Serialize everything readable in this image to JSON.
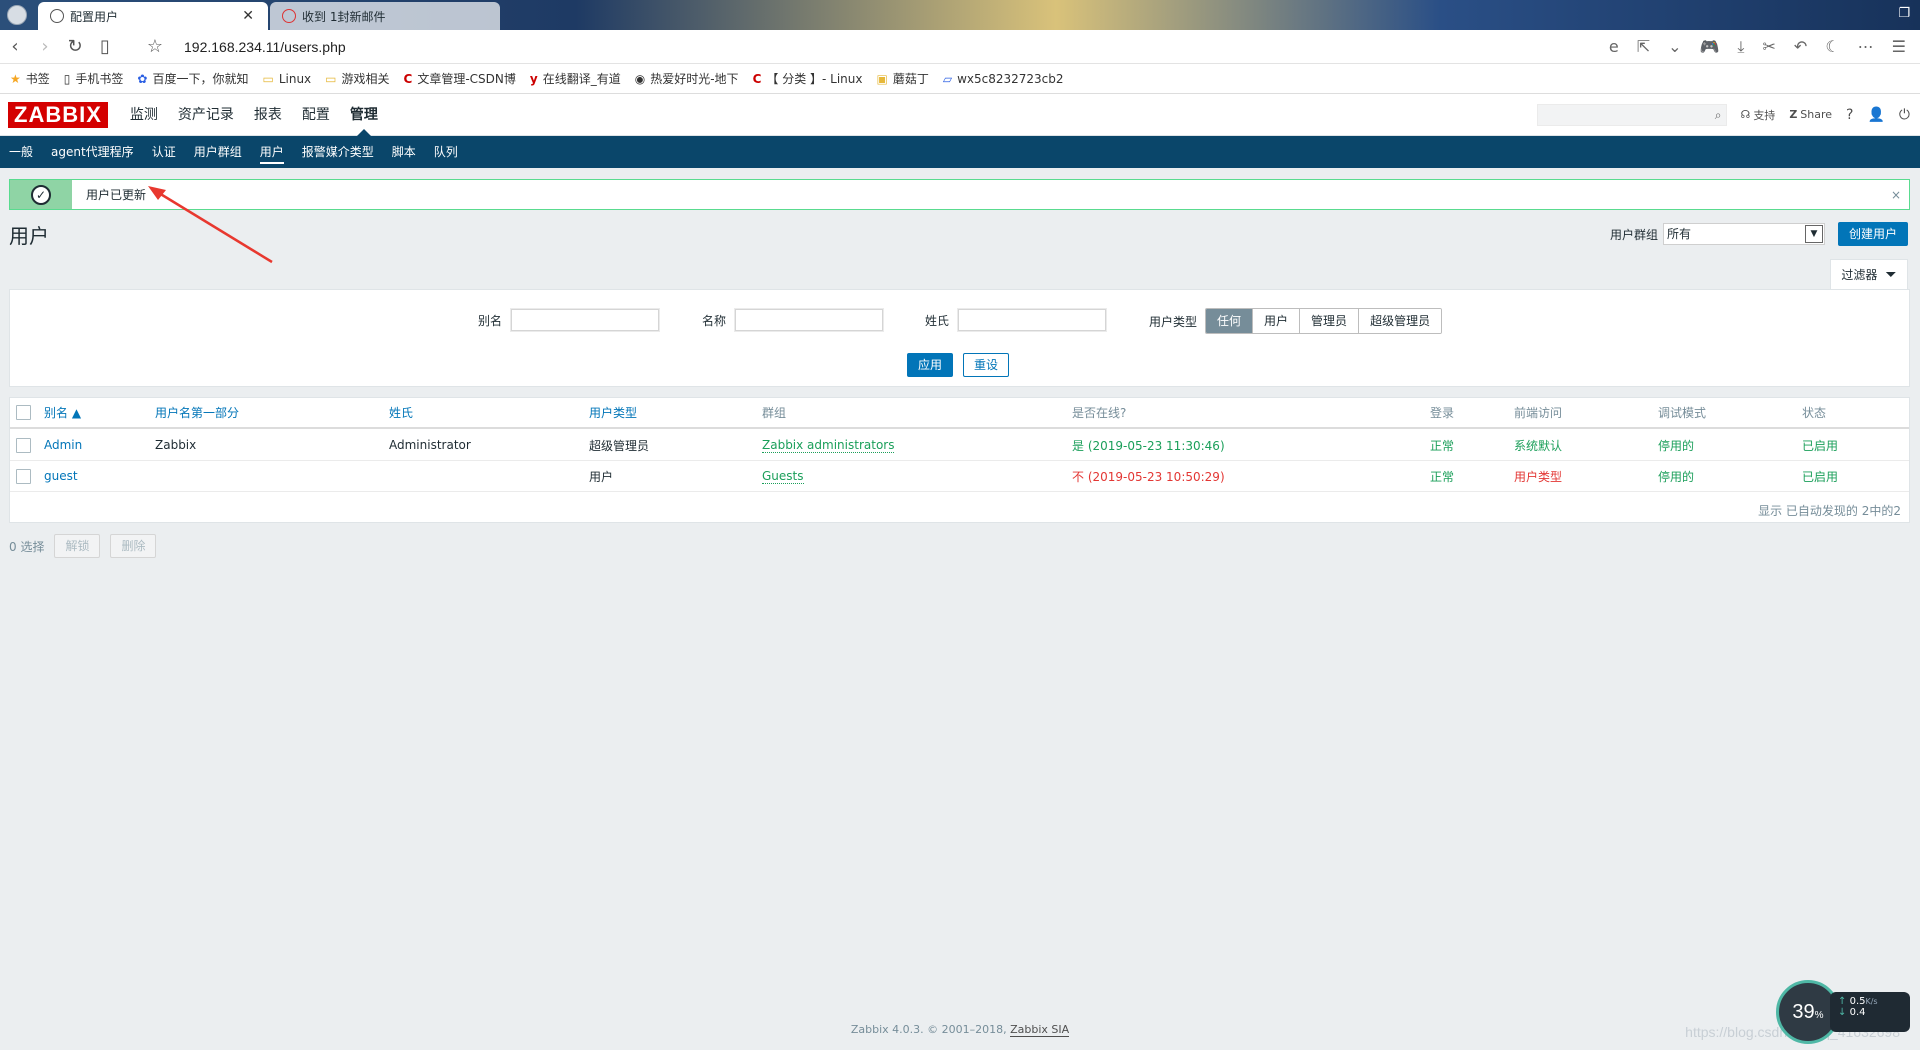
{
  "browser": {
    "active_tab": "配置用户",
    "inactive_tab": "收到 1封新邮件",
    "url": "192.168.234.11/users.php",
    "bookmarks": [
      "书签",
      "手机书签",
      "百度一下，你就知",
      "Linux",
      "游戏相关",
      "文章管理-CSDN博",
      "在线翻译_有道",
      "热爱好时光-地下",
      "【 分类 】- Linux",
      "蘑菇丁",
      "wx5c8232723cb2"
    ]
  },
  "header": {
    "logo": "ZABBIX",
    "menu": [
      "监测",
      "资产记录",
      "报表",
      "配置",
      "管理"
    ],
    "selected_menu": "管理",
    "support": "支持",
    "share": "Share",
    "help": "?"
  },
  "subnav": [
    "一般",
    "agent代理程序",
    "认证",
    "用户群组",
    "用户",
    "报警媒介类型",
    "脚本",
    "队列"
  ],
  "message": {
    "text": "用户已更新",
    "close": "×"
  },
  "page": {
    "title": "用户",
    "group_label": "用户群组",
    "group_value": "所有",
    "create_button": "创建用户"
  },
  "filter": {
    "tab_label": "过滤器",
    "alias_label": "别名",
    "name_label": "名称",
    "surname_label": "姓氏",
    "type_label": "用户类型",
    "types": [
      "任何",
      "用户",
      "管理员",
      "超级管理员"
    ],
    "selected_type": "任何",
    "apply": "应用",
    "reset": "重设"
  },
  "table": {
    "headers": [
      "别名 ▲",
      "用户名第一部分",
      "姓氏",
      "用户类型",
      "群组",
      "是否在线?",
      "登录",
      "前端访问",
      "调试模式",
      "状态"
    ],
    "rows": [
      {
        "alias": "Admin",
        "name": "Zabbix",
        "surname": "Administrator",
        "type": "超级管理员",
        "group": "Zabbix administrators",
        "online": "是 (2019-05-23 11:30:46)",
        "login": "正常",
        "frontend": "系统默认",
        "debug": "停用的",
        "status": "已启用"
      },
      {
        "alias": "guest",
        "name": "",
        "surname": "",
        "type": "用户",
        "group": "Guests",
        "online": "不 (2019-05-23 10:50:29)",
        "login": "正常",
        "frontend": "用户类型",
        "debug": "停用的",
        "status": "已启用"
      }
    ],
    "paging": "显示 已自动发现的 2中的2"
  },
  "actions": {
    "selected": "0 选择",
    "unblock": "解锁",
    "delete": "删除"
  },
  "footer": {
    "text": "Zabbix 4.0.3. © 2001–2018, ",
    "link": "Zabbix SIA"
  },
  "widget": {
    "percent": "39",
    "percent_unit": "%",
    "speed": "0.5",
    "speed_unit": "K/s",
    "speed2": "0.4"
  },
  "watermark": "https://blog.csdn.net/qq_41632698",
  "colors": {
    "zabbix_red": "#d40000",
    "nav_blue": "#0a466a",
    "primary": "#0275b8",
    "success": "#1b9f5a",
    "error": "#e33734"
  }
}
